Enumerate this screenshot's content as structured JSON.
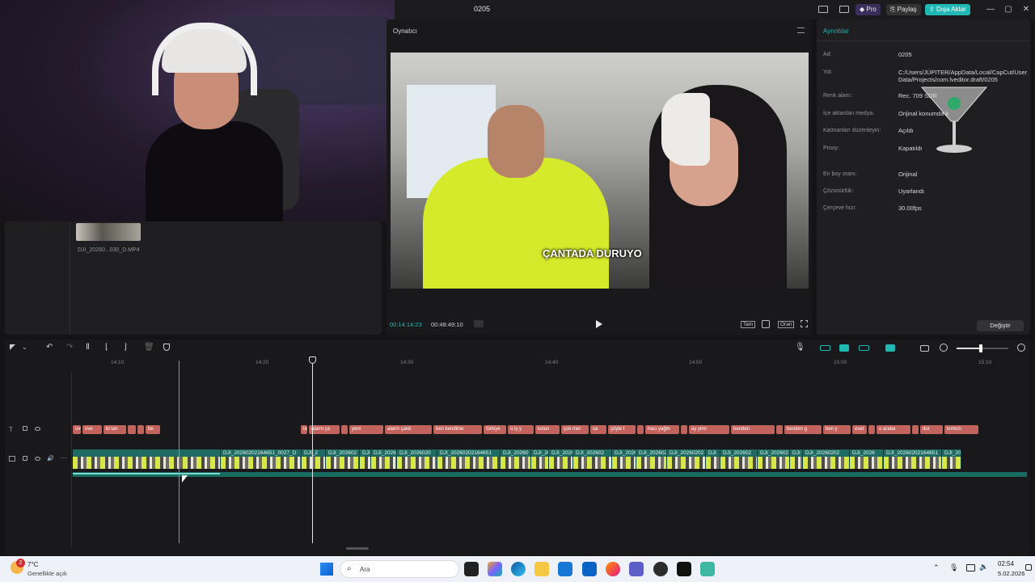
{
  "titlebar": {
    "project_name": "0205",
    "pro_label": "Pro",
    "share_label": "Paylaş",
    "export_label": "Dışa Aktar"
  },
  "player": {
    "title": "Oynatıcı",
    "current_time": "00:14:14:23",
    "total_time": "00:48:49:10",
    "caption": "ÇANTADA DURUYO",
    "full_label": "Tam",
    "ratio_label": "Oran"
  },
  "media": {
    "clip_name": "DJI_20260...030_D.MP4"
  },
  "details": {
    "title": "Ayrıntılar",
    "rows": [
      {
        "label": "Ad:",
        "value": "0205"
      },
      {
        "label": "Yol:",
        "value": "C:/Users/JÜPITER/AppData/Local/CapCut/User Data/Projects/com.lveditor.draft/0205"
      },
      {
        "label": "Renk alanı:",
        "value": "Rec. 709 SDR"
      },
      {
        "label": "İçe aktarılan medya:",
        "value": "Orijinal konumda k"
      },
      {
        "label": "Katmanları düzenleyin:",
        "value": "Açıldı"
      },
      {
        "label": "Proxy:",
        "value": "Kapatıldı"
      },
      {
        "label": "En boy oranı:",
        "value": "Orijinal"
      },
      {
        "label": "Çözünürlük:",
        "value": "Uyarlandı"
      },
      {
        "label": "Çerçeve hızı:",
        "value": "30.00fps"
      }
    ],
    "change_button": "Değiştir"
  },
  "timeline": {
    "ruler": [
      "14:10",
      "14:20",
      "14:30",
      "14:40",
      "14:50",
      "15:00",
      "15:10"
    ],
    "text_chips": [
      "uv",
      "uve",
      "bi tan",
      "",
      "",
      "be",
      "te",
      "alarm ça",
      "",
      "yeni",
      "alarm çaldı",
      "ben kendime",
      "türkiye",
      "o iş y",
      "kolun",
      "çok mer",
      "sa",
      "şöyle f",
      "",
      "hacı yağm",
      "",
      "ay yimi",
      "benden",
      "",
      "benden g",
      "ben y",
      "evet",
      "",
      "o araba",
      "",
      "dor",
      "kırmızı"
    ],
    "clips": [
      "",
      "DJI_20260202164651_0027_D",
      "DJI_2",
      "DJI_202602",
      "DJI",
      "DJI_2026",
      "DJI_2026020",
      "DJI_20260202164651",
      "DJI_20260",
      "DJI_202",
      "DJI_2026",
      "DJI_202602",
      "DJI_2026",
      "DJI_202602",
      "DJI_20260202",
      "DJI",
      "DJI_202602",
      "DJI_202602",
      "DJI",
      "DJI_20260202",
      "DJI_2026",
      "DJI_20260202164651",
      "DJI_20260"
    ]
  },
  "taskbar": {
    "weather_temp": "7°C",
    "weather_desc": "Genellikle açık",
    "weather_badge": "2",
    "search_placeholder": "Ara",
    "time": "02:54",
    "date": "5.02.2026"
  },
  "colors": {
    "accent": "#1fb8b4",
    "export_bg": "#1fb8b4",
    "clip": "#1d6b63",
    "text_chip": "#c2635d"
  }
}
